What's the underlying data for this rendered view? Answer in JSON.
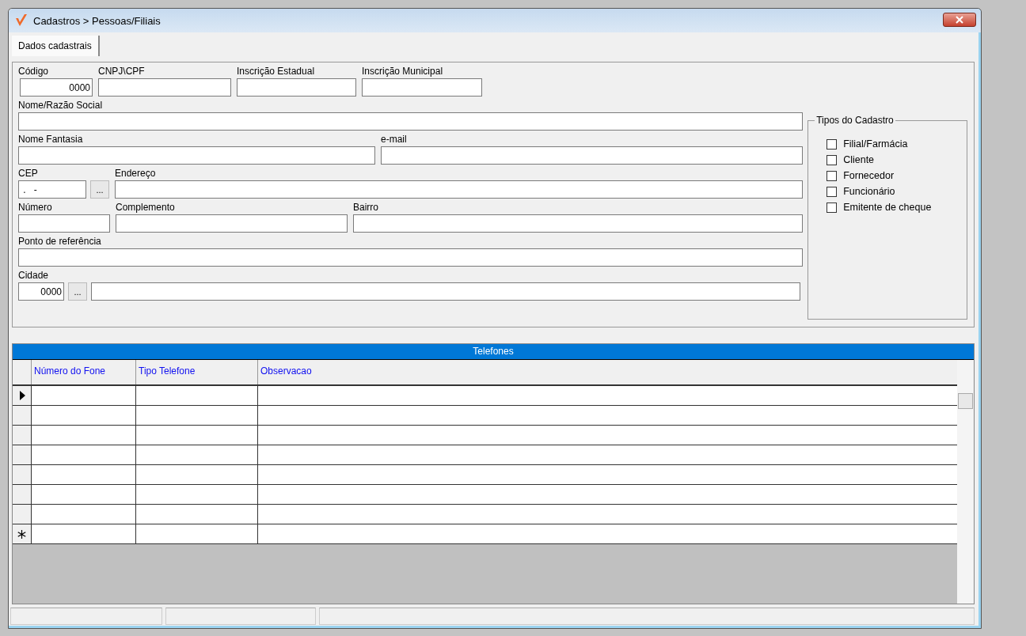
{
  "window": {
    "title": "Cadastros > Pessoas/Filiais"
  },
  "tabs": [
    {
      "label": "Dados cadastrais",
      "selected": true
    }
  ],
  "form": {
    "codigo": {
      "label": "Código",
      "value": "0000"
    },
    "cnpj_cpf": {
      "label": "CNPJ\\CPF"
    },
    "inscricao_estadual": {
      "label": "Inscrição Estadual"
    },
    "inscricao_municipal": {
      "label": "Inscrição Municipal"
    },
    "nome_razao_social": {
      "label": "Nome/Razão Social"
    },
    "nome_fantasia": {
      "label": "Nome Fantasia"
    },
    "email": {
      "label": "e-mail"
    },
    "cep": {
      "label": "CEP",
      "value": " .   -",
      "button": "..."
    },
    "endereco": {
      "label": "Endereço"
    },
    "numero": {
      "label": "Número"
    },
    "complemento": {
      "label": "Complemento"
    },
    "bairro": {
      "label": "Bairro"
    },
    "ponto_referencia": {
      "label": "Ponto de referência"
    },
    "cidade": {
      "label": "Cidade",
      "value": "0000",
      "button": "..."
    }
  },
  "tipos_do_cadastro": {
    "title": "Tipos do Cadastro",
    "items": [
      {
        "label": "Filial/Farmácia",
        "checked": false
      },
      {
        "label": "Cliente",
        "checked": false
      },
      {
        "label": "Fornecedor",
        "checked": false
      },
      {
        "label": "Funcionário",
        "checked": false
      },
      {
        "label": "Emitente de cheque",
        "checked": false
      }
    ]
  },
  "telefones": {
    "title": "Telefones",
    "columns": [
      "Número do Fone",
      "Tipo Telefone",
      "Observacao"
    ],
    "rows": [
      {
        "kind": "current"
      },
      {
        "kind": "empty"
      },
      {
        "kind": "empty"
      },
      {
        "kind": "empty"
      },
      {
        "kind": "empty"
      },
      {
        "kind": "empty"
      },
      {
        "kind": "empty"
      },
      {
        "kind": "new"
      }
    ]
  }
}
